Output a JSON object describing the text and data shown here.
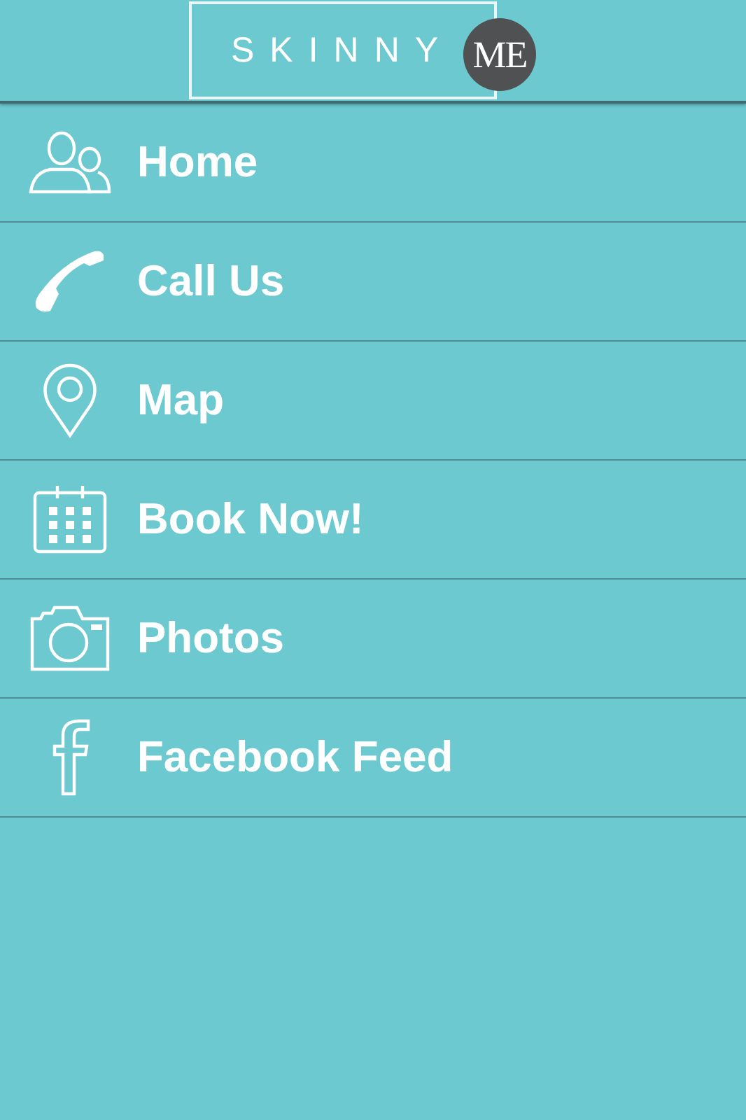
{
  "logo": {
    "word": "SKINNY",
    "badge": "ME"
  },
  "menu": [
    {
      "kind": "people",
      "label": "Home"
    },
    {
      "kind": "phone",
      "label": "Call Us"
    },
    {
      "kind": "pin",
      "label": "Map"
    },
    {
      "kind": "calendar",
      "label": "Book Now!"
    },
    {
      "kind": "camera",
      "label": "Photos"
    },
    {
      "kind": "facebook",
      "label": "Facebook Feed"
    }
  ]
}
